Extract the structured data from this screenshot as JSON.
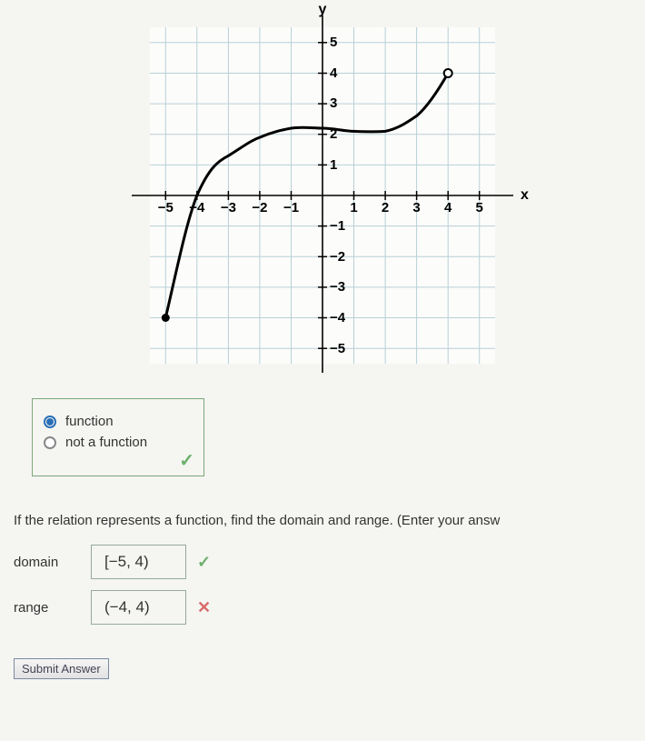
{
  "chart_data": {
    "type": "line",
    "title": "",
    "xlabel": "x",
    "ylabel": "y",
    "xlim": [
      -5.5,
      5.5
    ],
    "ylim": [
      -5.5,
      5.5
    ],
    "x_ticks": [
      -5,
      -4,
      -3,
      -2,
      -1,
      1,
      2,
      3,
      4,
      5
    ],
    "y_ticks": [
      -5,
      -4,
      -3,
      -2,
      -1,
      1,
      2,
      3,
      4,
      5
    ],
    "series": [
      {
        "name": "curve",
        "points": [
          {
            "x": -5,
            "y": -4
          },
          {
            "x": -4,
            "y": 0
          },
          {
            "x": -3,
            "y": 1.3
          },
          {
            "x": -2,
            "y": 1.9
          },
          {
            "x": -1,
            "y": 2.2
          },
          {
            "x": 0,
            "y": 2.2
          },
          {
            "x": 1,
            "y": 2.1
          },
          {
            "x": 2,
            "y": 2.1
          },
          {
            "x": 3,
            "y": 2.6
          },
          {
            "x": 4,
            "y": 4
          }
        ],
        "start_endpoint": {
          "x": -5,
          "y": -4,
          "closed": true
        },
        "end_endpoint": {
          "x": 4,
          "y": 4,
          "closed": false
        }
      }
    ]
  },
  "radio": {
    "option1": "function",
    "option2": "not a function",
    "selected": "function"
  },
  "instruction_text": "If the relation represents a function, find the domain and range. (Enter your answ",
  "answers": {
    "domain": {
      "label": "domain",
      "value": "[−5, 4)",
      "correct": true
    },
    "range": {
      "label": "range",
      "value": "(−4, 4)",
      "correct": false
    }
  },
  "submit_label": "Submit Answer"
}
